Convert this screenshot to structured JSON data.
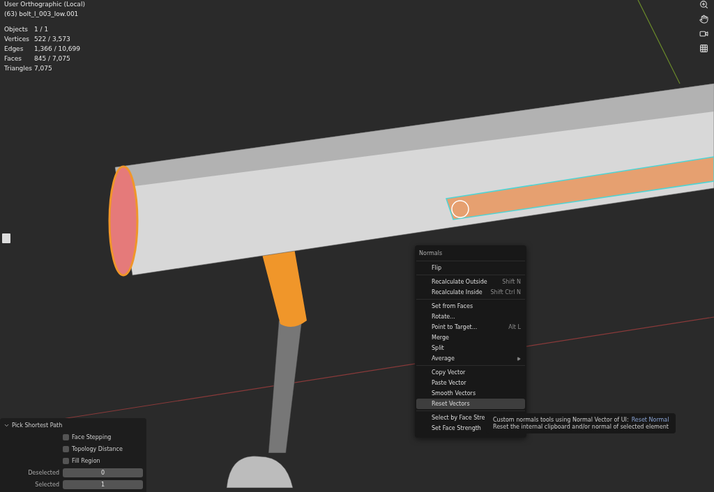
{
  "viewport": {
    "view_name": "User Orthographic (Local)",
    "object_name": "(63) bolt_l_003_low.001",
    "stats": [
      {
        "label": "Objects",
        "value": "1 / 1"
      },
      {
        "label": "Vertices",
        "value": "522 / 3,573"
      },
      {
        "label": "Edges",
        "value": "1,366 / 10,699"
      },
      {
        "label": "Faces",
        "value": "845 / 7,075"
      },
      {
        "label": "Triangles",
        "value": "7,075"
      }
    ]
  },
  "menu": {
    "title": "Normals",
    "sections": [
      [
        {
          "label": "Flip",
          "selected": false,
          "submenu": false
        }
      ],
      [
        {
          "label": "Recalculate Outside",
          "shortcut": "Shift N",
          "selected": false,
          "submenu": false
        },
        {
          "label": "Recalculate Inside",
          "shortcut": "Shift Ctrl N",
          "selected": false,
          "submenu": false
        }
      ],
      [
        {
          "label": "Set from Faces",
          "selected": false,
          "submenu": false
        },
        {
          "label": "Rotate...",
          "selected": false,
          "submenu": false
        },
        {
          "label": "Point to Target...",
          "shortcut": "Alt L",
          "selected": false,
          "submenu": false
        },
        {
          "label": "Merge",
          "selected": false,
          "submenu": false
        },
        {
          "label": "Split",
          "selected": false,
          "submenu": false
        },
        {
          "label": "Average",
          "selected": false,
          "submenu": true
        }
      ],
      [
        {
          "label": "Copy Vector",
          "selected": false,
          "submenu": false
        },
        {
          "label": "Paste Vector",
          "selected": false,
          "submenu": false
        },
        {
          "label": "Smooth Vectors",
          "selected": false,
          "submenu": false
        },
        {
          "label": "Reset Vectors",
          "selected": true,
          "submenu": false
        }
      ],
      [
        {
          "label": "Select by Face Stre",
          "selected": false,
          "submenu": false
        },
        {
          "label": "Set Face Strength",
          "selected": false,
          "submenu": false
        }
      ]
    ]
  },
  "tooltip": {
    "description": "Custom normals tools using Normal Vector of UI:",
    "operator": "Reset Normal",
    "detail": "Reset the internal clipboard and/or normal of selected element"
  },
  "panel": {
    "title": "Pick Shortest Path",
    "expanded": true,
    "checkboxes": [
      {
        "label": "Face Stepping",
        "checked": false
      },
      {
        "label": "Topology Distance",
        "checked": false
      },
      {
        "label": "Fill Region",
        "checked": false
      }
    ],
    "fields": [
      {
        "label": "Deselected",
        "value": "0"
      },
      {
        "label": "Selected",
        "value": "1"
      }
    ]
  }
}
